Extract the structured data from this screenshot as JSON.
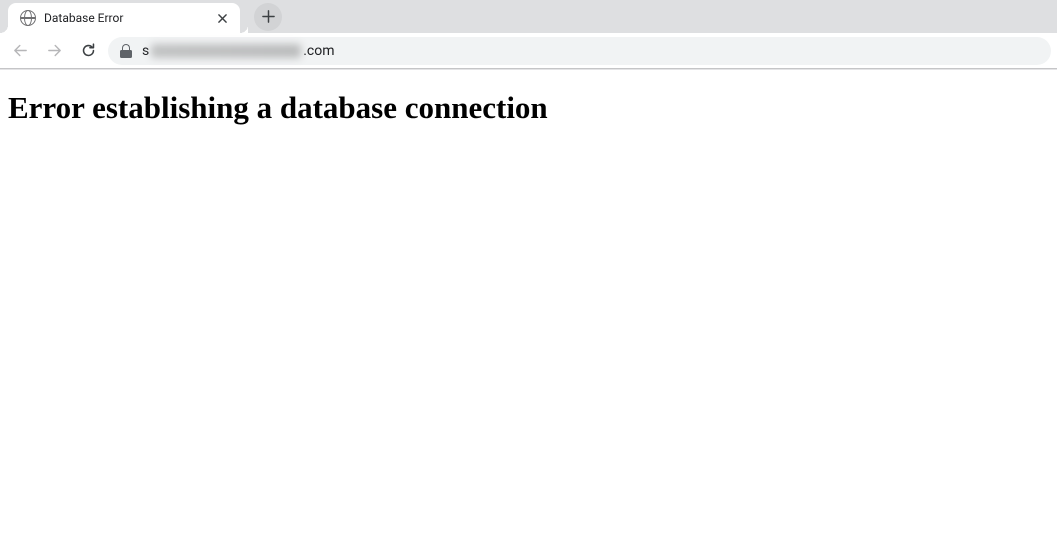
{
  "browser": {
    "tab": {
      "title": "Database Error"
    },
    "url": {
      "visible_suffix": ".com"
    }
  },
  "page": {
    "heading": "Error establishing a database connection"
  }
}
